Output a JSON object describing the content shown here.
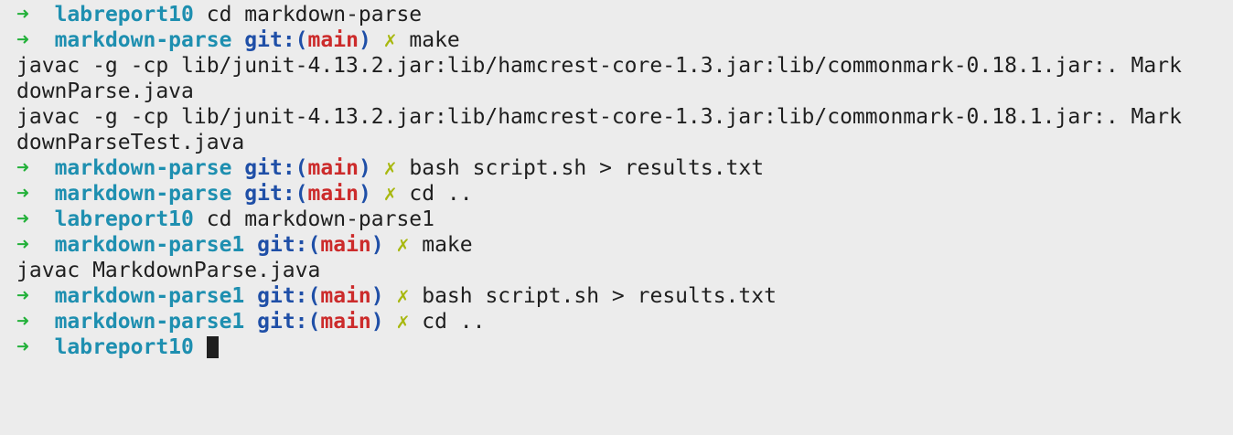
{
  "terminal": {
    "prompt_arrow": "➜",
    "git_prefix": "git:(",
    "git_suffix": ")",
    "dirty_mark": "✗",
    "lines": [
      {
        "dir": "labreport10",
        "cmd": "cd markdown-parse"
      },
      {
        "dir": "markdown-parse",
        "branch": "main",
        "cmd": "make"
      },
      {
        "out": "javac -g -cp lib/junit-4.13.2.jar:lib/hamcrest-core-1.3.jar:lib/commonmark-0.18.1.jar:. Mark"
      },
      {
        "out": "downParse.java"
      },
      {
        "out": "javac -g -cp lib/junit-4.13.2.jar:lib/hamcrest-core-1.3.jar:lib/commonmark-0.18.1.jar:. Mark"
      },
      {
        "out": "downParseTest.java"
      },
      {
        "dir": "markdown-parse",
        "branch": "main",
        "cmd": "bash script.sh > results.txt"
      },
      {
        "dir": "markdown-parse",
        "branch": "main",
        "cmd": "cd .."
      },
      {
        "dir": "labreport10",
        "cmd": "cd markdown-parse1"
      },
      {
        "dir": "markdown-parse1",
        "branch": "main",
        "cmd": "make"
      },
      {
        "out": "javac MarkdownParse.java"
      },
      {
        "dir": "markdown-parse1",
        "branch": "main",
        "cmd": "bash script.sh > results.txt"
      },
      {
        "dir": "markdown-parse1",
        "branch": "main",
        "cmd": "cd .."
      },
      {
        "dir": "labreport10",
        "cmd": ""
      }
    ]
  },
  "colors": {
    "background": "#ececec",
    "prompt_arrow": "#23b13a",
    "directory": "#1e8fb0",
    "git_label": "#1f4fa7",
    "branch": "#cc2b2b",
    "dirty_mark": "#a8b80f",
    "text": "#1f1f1f"
  }
}
